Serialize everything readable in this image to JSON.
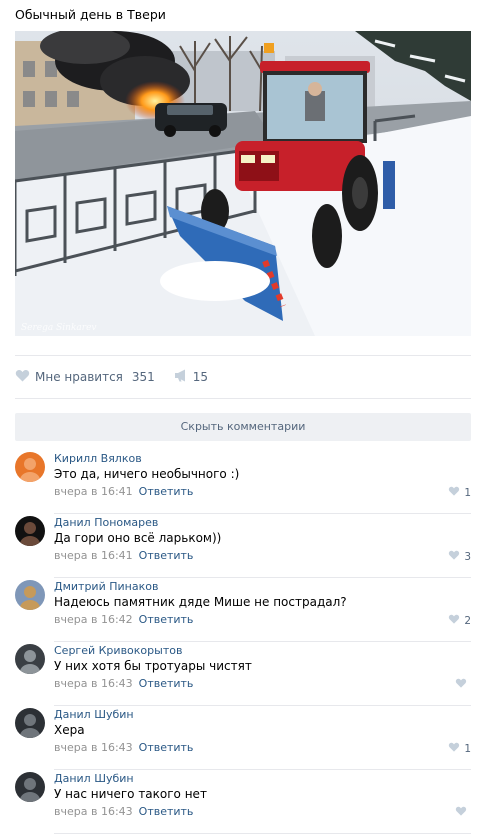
{
  "post": {
    "title": "Обычный день в Твери",
    "photo_caption": "Serega Sinkarev"
  },
  "actions": {
    "like_label": "Мне нравится",
    "like_count": "351",
    "share_count": "15"
  },
  "comments_toggle": "Скрыть комментарии",
  "comments": [
    {
      "author": "Кирилл Вялков",
      "text": "Это да, ничего необычного :)",
      "time": "вчера в 16:41",
      "reply": "Ответить",
      "likes": "1"
    },
    {
      "author": "Данил Пономарев",
      "text": "Да гори оно всё ларьком))",
      "time": "вчера в 16:41",
      "reply": "Ответить",
      "likes": "3"
    },
    {
      "author": "Дмитрий Пинаков",
      "text": "Надеюсь памятник дяде Мише не пострадал?",
      "time": "вчера в 16:42",
      "reply": "Ответить",
      "likes": "2"
    },
    {
      "author": "Сергей Кривокорытов",
      "text": "У них хотя бы тротуары чистят",
      "time": "вчера в 16:43",
      "reply": "Ответить",
      "likes": ""
    },
    {
      "author": "Данил Шубин",
      "text": "Хера",
      "time": "вчера в 16:43",
      "reply": "Ответить",
      "likes": "1"
    },
    {
      "author": "Данил Шубин",
      "text": "У нас ничего такого нет",
      "time": "вчера в 16:43",
      "reply": "Ответить",
      "likes": ""
    }
  ],
  "colors": {
    "link": "#2a5885",
    "meta": "#939393",
    "icon": "#c5d0db",
    "accent": "#55677d"
  },
  "icons": {
    "like": "heart-icon",
    "share": "megaphone-icon"
  }
}
